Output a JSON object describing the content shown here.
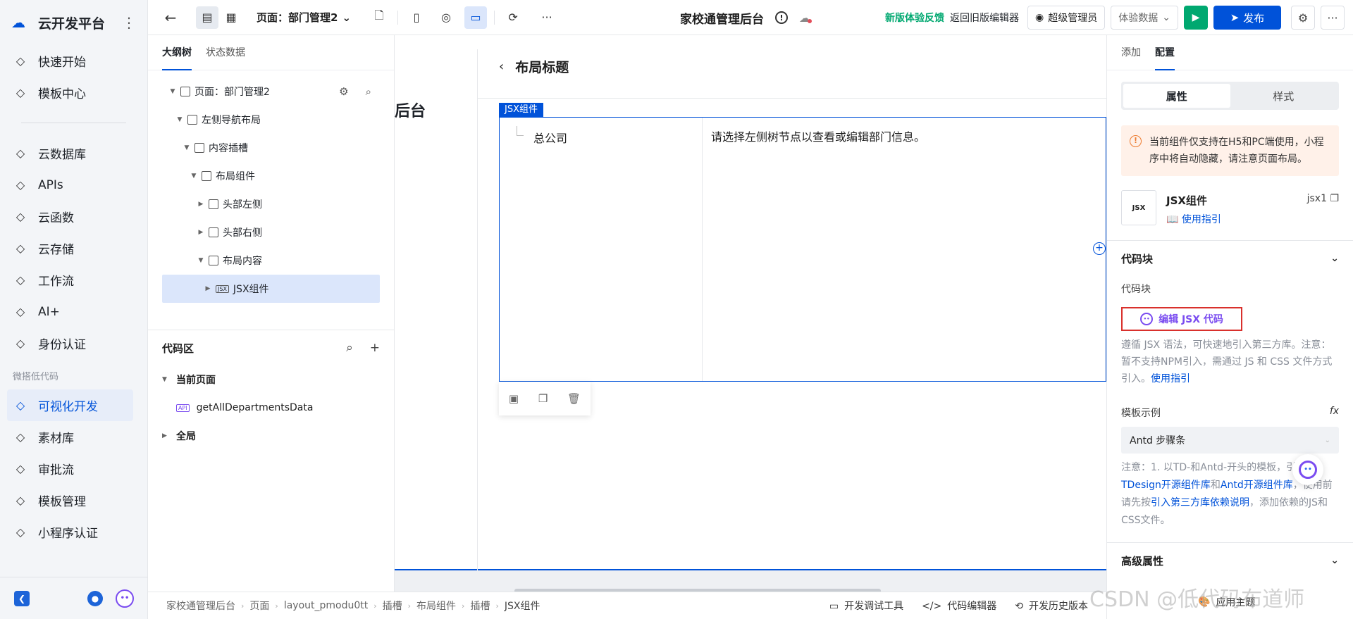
{
  "sidebar": {
    "brand": "云开发平台",
    "items_top": [
      {
        "label": "快速开始",
        "icon": "flag-icon"
      },
      {
        "label": "模板中心",
        "icon": "template-icon"
      }
    ],
    "items_mid": [
      {
        "label": "云数据库",
        "icon": "database-icon"
      },
      {
        "label": "APIs",
        "icon": "link-icon"
      },
      {
        "label": "云函数",
        "icon": "function-icon"
      },
      {
        "label": "云存储",
        "icon": "folder-icon"
      },
      {
        "label": "工作流",
        "icon": "workflow-icon"
      },
      {
        "label": "AI+",
        "icon": "robot-icon"
      },
      {
        "label": "身份认证",
        "icon": "id-card-icon"
      }
    ],
    "section_lowcode": "微搭低代码",
    "items_lowcode": [
      {
        "label": "可视化开发",
        "icon": "layout-icon",
        "active": true
      },
      {
        "label": "素材库",
        "icon": "assets-icon"
      },
      {
        "label": "审批流",
        "icon": "stamp-icon"
      },
      {
        "label": "模板管理",
        "icon": "template-manage-icon"
      },
      {
        "label": "小程序认证",
        "icon": "miniprogram-icon"
      }
    ]
  },
  "topbar": {
    "page_select": "页面：部门管理2",
    "app_title": "家校通管理后台",
    "feedback": "新版体验反馈",
    "back_old": "返回旧版编辑器",
    "user": "超级管理员",
    "data_select": "体验数据",
    "publish": "发布"
  },
  "outline": {
    "tabs": [
      "大纲树",
      "状态数据"
    ],
    "tree": [
      {
        "label": "页面：部门管理2",
        "depth": 0,
        "caret": "▼"
      },
      {
        "label": "左侧导航布局",
        "depth": 1,
        "caret": "▼"
      },
      {
        "label": "内容插槽",
        "depth": 2,
        "caret": "▼"
      },
      {
        "label": "布局组件",
        "depth": 3,
        "caret": "▼"
      },
      {
        "label": "头部左侧",
        "depth": 4,
        "caret": "▶"
      },
      {
        "label": "头部右侧",
        "depth": 4,
        "caret": "▶"
      },
      {
        "label": "布局内容",
        "depth": 4,
        "caret": "▼"
      },
      {
        "label": "JSX组件",
        "depth": 5,
        "caret": "▶",
        "selected": true
      }
    ],
    "code_title": "代码区",
    "code_current": "当前页面",
    "code_fn": "getAllDepartmentsData",
    "code_global": "全局"
  },
  "canvas": {
    "left_title": "后台",
    "layout_title": "布局标题",
    "jsx_label": "JSX组件",
    "tree_node": "总公司",
    "hint": "请选择左侧树节点以查看或编辑部门信息。"
  },
  "config": {
    "tabs": [
      "添加",
      "配置"
    ],
    "seg": [
      "属性",
      "样式"
    ],
    "warning": "当前组件仅支持在H5和PC端使用，小程序中将自动隐藏，请注意页面布局。",
    "comp_name": "JSX组件",
    "comp_guide": "使用指引",
    "comp_id": "jsx1",
    "sec_code": "代码块",
    "field_code": "代码块",
    "edit_btn": "编辑 JSX 代码",
    "help_text": "遵循 JSX 语法，可快速地引入第三方库。注意：暂不支持NPM引入，需通过 JS 和 CSS 文件方式引入。",
    "help_link": "使用指引",
    "tpl_label": "模板示例",
    "tpl_value": "Antd 步骤条",
    "note_a": "注意：1. 以TD-和Antd-开头的模板，",
    "note_b": "引入",
    "note_link1": "TDesign开源组件库",
    "note_and": "和",
    "note_link2": "Antd开源组件库",
    "note_c": "，使用前请先按",
    "note_link3": "引入第三方库依赖说明",
    "note_d": "，添加依赖的JS和CSS文件。",
    "sec_advanced": "高级属性",
    "theme": "应用主题"
  },
  "statusbar": {
    "crumbs": [
      "家校通管理后台",
      "页面",
      "layout_pmodu0tt",
      "插槽",
      "布局组件",
      "插槽",
      "JSX组件"
    ],
    "tools": [
      "开发调试工具",
      "代码编辑器",
      "开发历史版本"
    ]
  },
  "watermark": "CSDN @低代码布道师"
}
